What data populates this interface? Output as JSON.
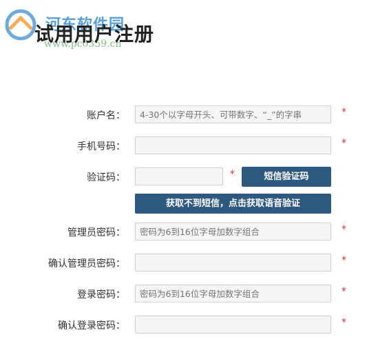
{
  "watermark": {
    "site_name": "河东软件园",
    "url": "www.pc0359.cn"
  },
  "page": {
    "title": "试用用户注册"
  },
  "form": {
    "fields": [
      {
        "label": "账户名：",
        "value": "",
        "placeholder": "4-30个以字母开头、可带数字、“_”的字串",
        "required": "*"
      },
      {
        "label": "手机号码：",
        "value": "",
        "placeholder": "",
        "required": "*"
      },
      {
        "label": "验证码：",
        "value": "",
        "placeholder": "",
        "required": "*"
      },
      {
        "label": "管理员密码：",
        "value": "",
        "placeholder": "密码为6到16位字母加数字组合",
        "required": "*"
      },
      {
        "label": "确认管理员密码：",
        "value": "",
        "placeholder": "",
        "required": "*"
      },
      {
        "label": "登录密码：",
        "value": "",
        "placeholder": "密码为6到16位字母加数字组合",
        "required": "*"
      },
      {
        "label": "确认登录密码：",
        "value": "",
        "placeholder": "",
        "required": "*"
      }
    ],
    "sms_button": "短信验证码",
    "voice_button": "获取不到短信，点击获取语音验证"
  },
  "colors": {
    "button_bg": "#2d587f",
    "required_star": "#d9333a"
  }
}
